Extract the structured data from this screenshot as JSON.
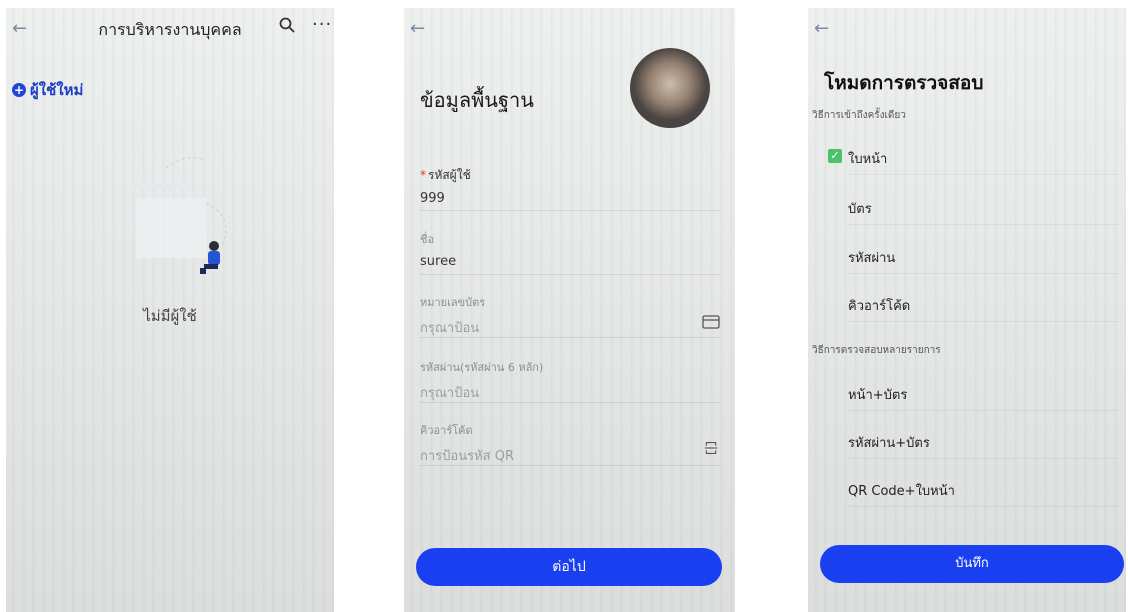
{
  "screen1": {
    "back_icon": "arrow-left-icon",
    "title": "การบริหารงานบุคคล",
    "search_icon": "search-icon",
    "more_icon": "more-icon",
    "more_glyph": "···",
    "add_glyph": "+",
    "add_user_label": "ผู้ใช้ใหม่",
    "empty_text": "ไม่มีผู้ใช้"
  },
  "screen2": {
    "back_icon": "arrow-left-icon",
    "title": "ข้อมูลพื้นฐาน",
    "fields": [
      {
        "label": "รหัสผู้ใช้",
        "required_mark": "*",
        "value": "999"
      },
      {
        "label": "ชื่อ",
        "value": "suree"
      },
      {
        "label": "หมายเลขบัตร",
        "placeholder": "กรุณาป้อน",
        "icon": "card-icon"
      },
      {
        "label": "รหัสผ่าน(รหัสผ่าน 6 หลัก)",
        "placeholder": "กรุณาป้อน"
      },
      {
        "label": "คิวอาร์โค้ด",
        "placeholder": "การป้อนรหัส QR",
        "icon": "scan-icon"
      }
    ],
    "next_label": "ต่อไป"
  },
  "screen3": {
    "back_icon": "arrow-left-icon",
    "title": "โหมดการตรวจสอบ",
    "single_section": "วิธีการเข้าถึงครั้งเดียว",
    "check_glyph": "✓",
    "single_options": [
      "ใบหน้า",
      "บัตร",
      "รหัสผ่าน",
      "คิวอาร์โค้ด"
    ],
    "multi_section": "วิธีการตรวจสอบหลายรายการ",
    "multi_options": [
      "หน้า+บัตร",
      "รหัสผ่าน+บัตร",
      "QR Code+ใบหน้า"
    ],
    "save_label": "บันทึก"
  },
  "colors": {
    "accent": "#1a3ff0",
    "check": "#4cc26a"
  }
}
